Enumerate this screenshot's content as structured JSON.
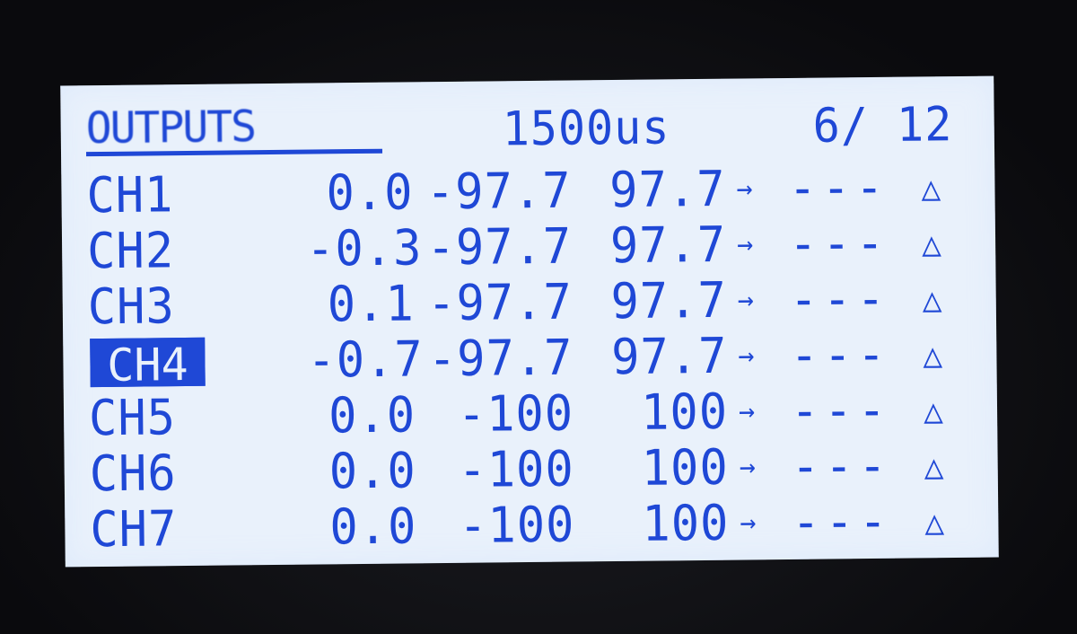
{
  "header": {
    "title": "OUTPUTS",
    "time_value": "1500us",
    "page": "6/ 12"
  },
  "channels": [
    {
      "name": "CH1",
      "subtrim": "0.0",
      "min": "-97.7",
      "max": "97.7",
      "arrow": "→",
      "ppm": "---",
      "icon": "triangle-icon"
    },
    {
      "name": "CH2",
      "subtrim": "-0.3",
      "min": "-97.7",
      "max": "97.7",
      "arrow": "→",
      "ppm": "---",
      "icon": "triangle-icon"
    },
    {
      "name": "CH3",
      "subtrim": "0.1",
      "min": "-97.7",
      "max": "97.7",
      "arrow": "→",
      "ppm": "---",
      "icon": "triangle-icon"
    },
    {
      "name": "CH4",
      "subtrim": "-0.7",
      "min": "-97.7",
      "max": "97.7",
      "arrow": "→",
      "ppm": "---",
      "icon": "triangle-icon",
      "selected": true
    },
    {
      "name": "CH5",
      "subtrim": "0.0",
      "min": "-100",
      "max": "100",
      "arrow": "→",
      "ppm": "---",
      "icon": "triangle-icon"
    },
    {
      "name": "CH6",
      "subtrim": "0.0",
      "min": "-100",
      "max": "100",
      "arrow": "→",
      "ppm": "---",
      "icon": "triangle-icon"
    },
    {
      "name": "CH7",
      "subtrim": "0.0",
      "min": "-100",
      "max": "100",
      "arrow": "→",
      "ppm": "---",
      "icon": "triangle-icon"
    }
  ],
  "colors": {
    "lcd_background": "#e9f1fb",
    "lcd_foreground": "#1f48d6",
    "bezel": "#0d0e12"
  }
}
